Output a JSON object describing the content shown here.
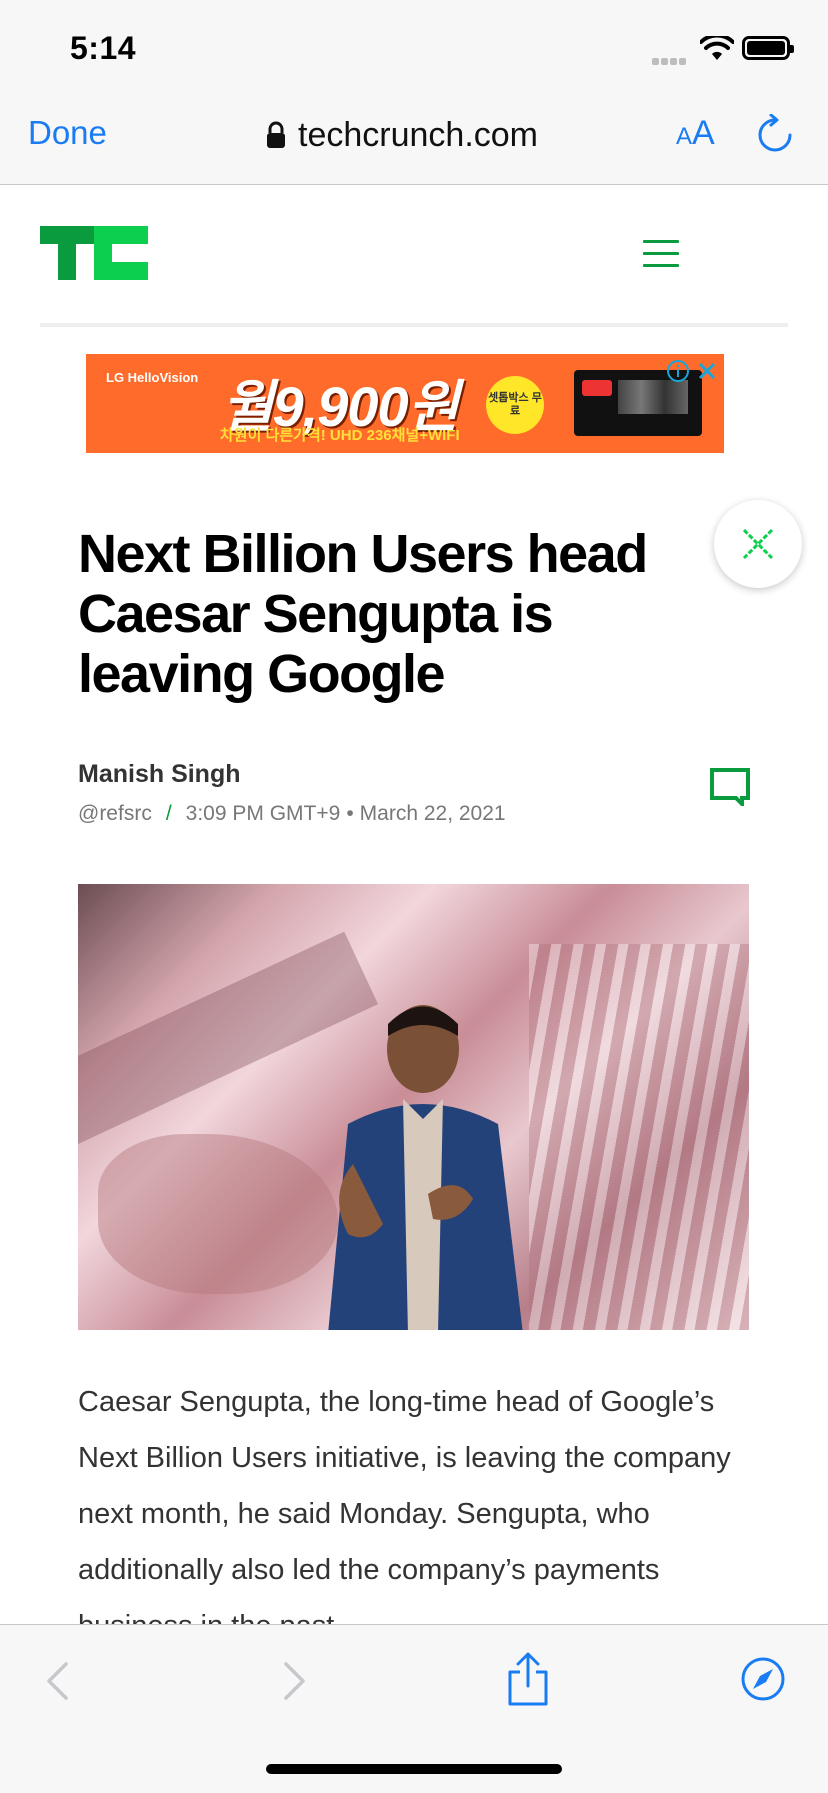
{
  "status_bar": {
    "time": "5:14"
  },
  "browser": {
    "done_label": "Done",
    "url": "techcrunch.com",
    "text_size_small": "A",
    "text_size_large": "A",
    "accent_color": "#1a7cf2"
  },
  "site": {
    "logo_text": "TC",
    "brand_color": "#0a9b3f"
  },
  "ad": {
    "brand": "LG HelloVision",
    "price_text": "월9,900원",
    "subtext": "차원이 다른가격! UHD 236채널+WIFI",
    "badge_text": "셋톱박스 무료"
  },
  "article": {
    "headline": "Next Billion Users head Caesar Sengupta is leaving Google",
    "author": "Manish Singh",
    "handle": "@refsrc",
    "separator": "/",
    "time": "3:09 PM GMT+9",
    "bullet": "•",
    "date": "March 22, 2021",
    "body": "Caesar Sengupta, the long-time head of Google’s Next Billion Users initiative, is leaving the company next month, he said Monday. Sengupta, who additionally also led the company’s payments business in the past"
  }
}
